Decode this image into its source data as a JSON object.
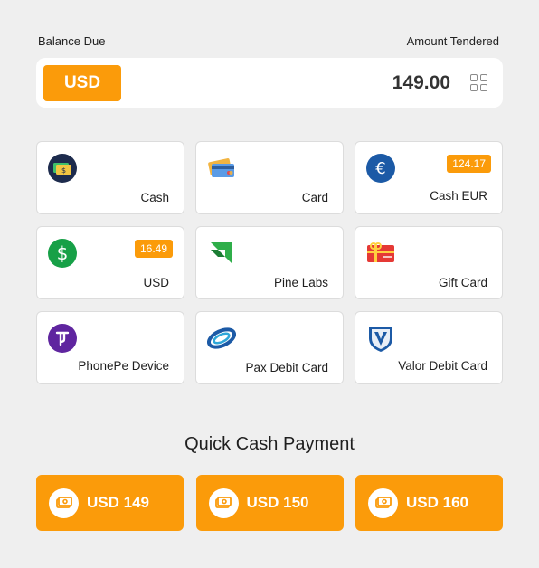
{
  "header": {
    "balance_due_label": "Balance Due",
    "amount_tendered_label": "Amount Tendered"
  },
  "amount_bar": {
    "currency": "USD",
    "amount": "149.00",
    "grid_icon": "grid-icon"
  },
  "methods": [
    {
      "label": "Cash",
      "icon": "cash-icon",
      "badge": ""
    },
    {
      "label": "Card",
      "icon": "credit-card-icon",
      "badge": ""
    },
    {
      "label": "Cash EUR",
      "icon": "euro-icon",
      "badge": "124.17"
    },
    {
      "label": "USD",
      "icon": "dollar-icon",
      "badge": "16.49"
    },
    {
      "label": "Pine Labs",
      "icon": "pine-labs-icon",
      "badge": ""
    },
    {
      "label": "Gift Card",
      "icon": "gift-card-icon",
      "badge": ""
    },
    {
      "label": "PhonePe Device",
      "icon": "phonepe-icon",
      "badge": ""
    },
    {
      "label": "Pax Debit Card",
      "icon": "pax-icon",
      "badge": ""
    },
    {
      "label": "Valor Debit Card",
      "icon": "valor-icon",
      "badge": ""
    }
  ],
  "quick_cash": {
    "title": "Quick Cash Payment",
    "buttons": [
      {
        "label": "USD 149",
        "icon": "cash-note-icon"
      },
      {
        "label": "USD 150",
        "icon": "cash-note-icon"
      },
      {
        "label": "USD 160",
        "icon": "cash-note-icon"
      }
    ]
  },
  "colors": {
    "accent": "#fb9b0a",
    "background": "#efefef",
    "card": "#ffffff"
  }
}
